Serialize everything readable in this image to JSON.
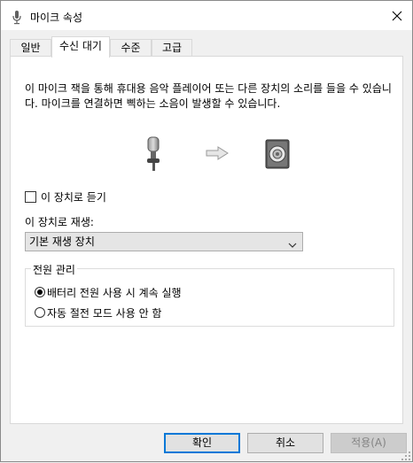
{
  "window": {
    "title": "마이크 속성"
  },
  "tabs": [
    {
      "label": "일반"
    },
    {
      "label": "수신 대기"
    },
    {
      "label": "수준"
    },
    {
      "label": "고급"
    }
  ],
  "listen": {
    "description": "이 마이크 잭을 통해 휴대용 음악 플레이어 또는 다른 장치의 소리를 들을 수 있습니다. 마이크를 연결하면 삑하는 소음이 발생할 수 있습니다.",
    "listen_checkbox_label": "이 장치로 듣기",
    "listen_checked": false,
    "playback_label": "이 장치로 재생:",
    "playback_value": "기본 재생 장치"
  },
  "power": {
    "legend": "전원 관리",
    "options": [
      {
        "label": "배터리 전원 사용 시 계속 실행",
        "checked": true
      },
      {
        "label": "자동 절전 모드 사용 안 함",
        "checked": false
      }
    ]
  },
  "buttons": {
    "ok": "확인",
    "cancel": "취소",
    "apply": "적용(A)"
  },
  "icons": {
    "title": "microphone-icon",
    "close": "close-icon",
    "mic": "microphone-icon",
    "arrow": "arrow-right-icon",
    "speaker": "speaker-icon",
    "dropdown": "chevron-down-icon"
  }
}
